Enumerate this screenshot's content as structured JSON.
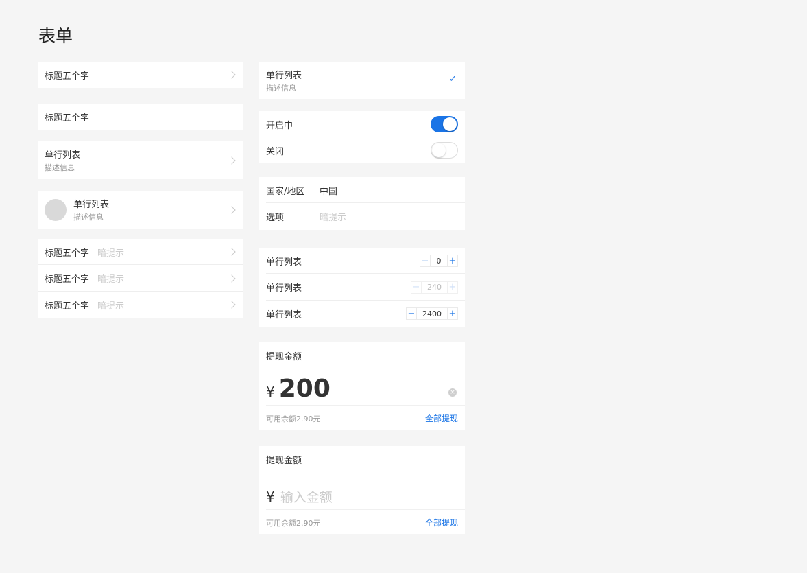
{
  "page": {
    "title": "表单"
  },
  "left": {
    "row_nav_title": "标题五个字",
    "row_plain_title": "标题五个字",
    "row_desc": {
      "title": "单行列表",
      "desc": "描述信息"
    },
    "row_avatar": {
      "title": "单行列表",
      "desc": "描述信息"
    },
    "group": [
      {
        "title": "标题五个字",
        "hint": "暗提示"
      },
      {
        "title": "标题五个字",
        "hint": "暗提示"
      },
      {
        "title": "标题五个字",
        "hint": "暗提示"
      }
    ]
  },
  "right": {
    "select_row": {
      "title": "单行列表",
      "desc": "描述信息",
      "checked": true
    },
    "switches": [
      {
        "label": "开启中",
        "on": true
      },
      {
        "label": "关闭",
        "on": false
      }
    ],
    "fields": [
      {
        "label": "国家/地区",
        "value": "中国"
      },
      {
        "label": "选项",
        "placeholder": "暗提示"
      }
    ],
    "steppers": [
      {
        "label": "单行列表",
        "minus": "−",
        "value": "0",
        "plus": "+"
      },
      {
        "label": "单行列表",
        "minus": "−",
        "value": "240",
        "plus": "+"
      },
      {
        "label": "单行列表",
        "minus": "−",
        "value": "2400",
        "plus": "+"
      }
    ],
    "withdraw1": {
      "label": "提现金额",
      "currency": "¥",
      "amount": "200",
      "balance": "可用余额2.90元",
      "action": "全部提现"
    },
    "withdraw2": {
      "label": "提现金额",
      "currency": "¥",
      "placeholder": "输入金额",
      "balance": "可用余额2.90元",
      "action": "全部提现"
    }
  },
  "colors": {
    "accent": "#1a74e6",
    "background": "#f5f5f5"
  }
}
